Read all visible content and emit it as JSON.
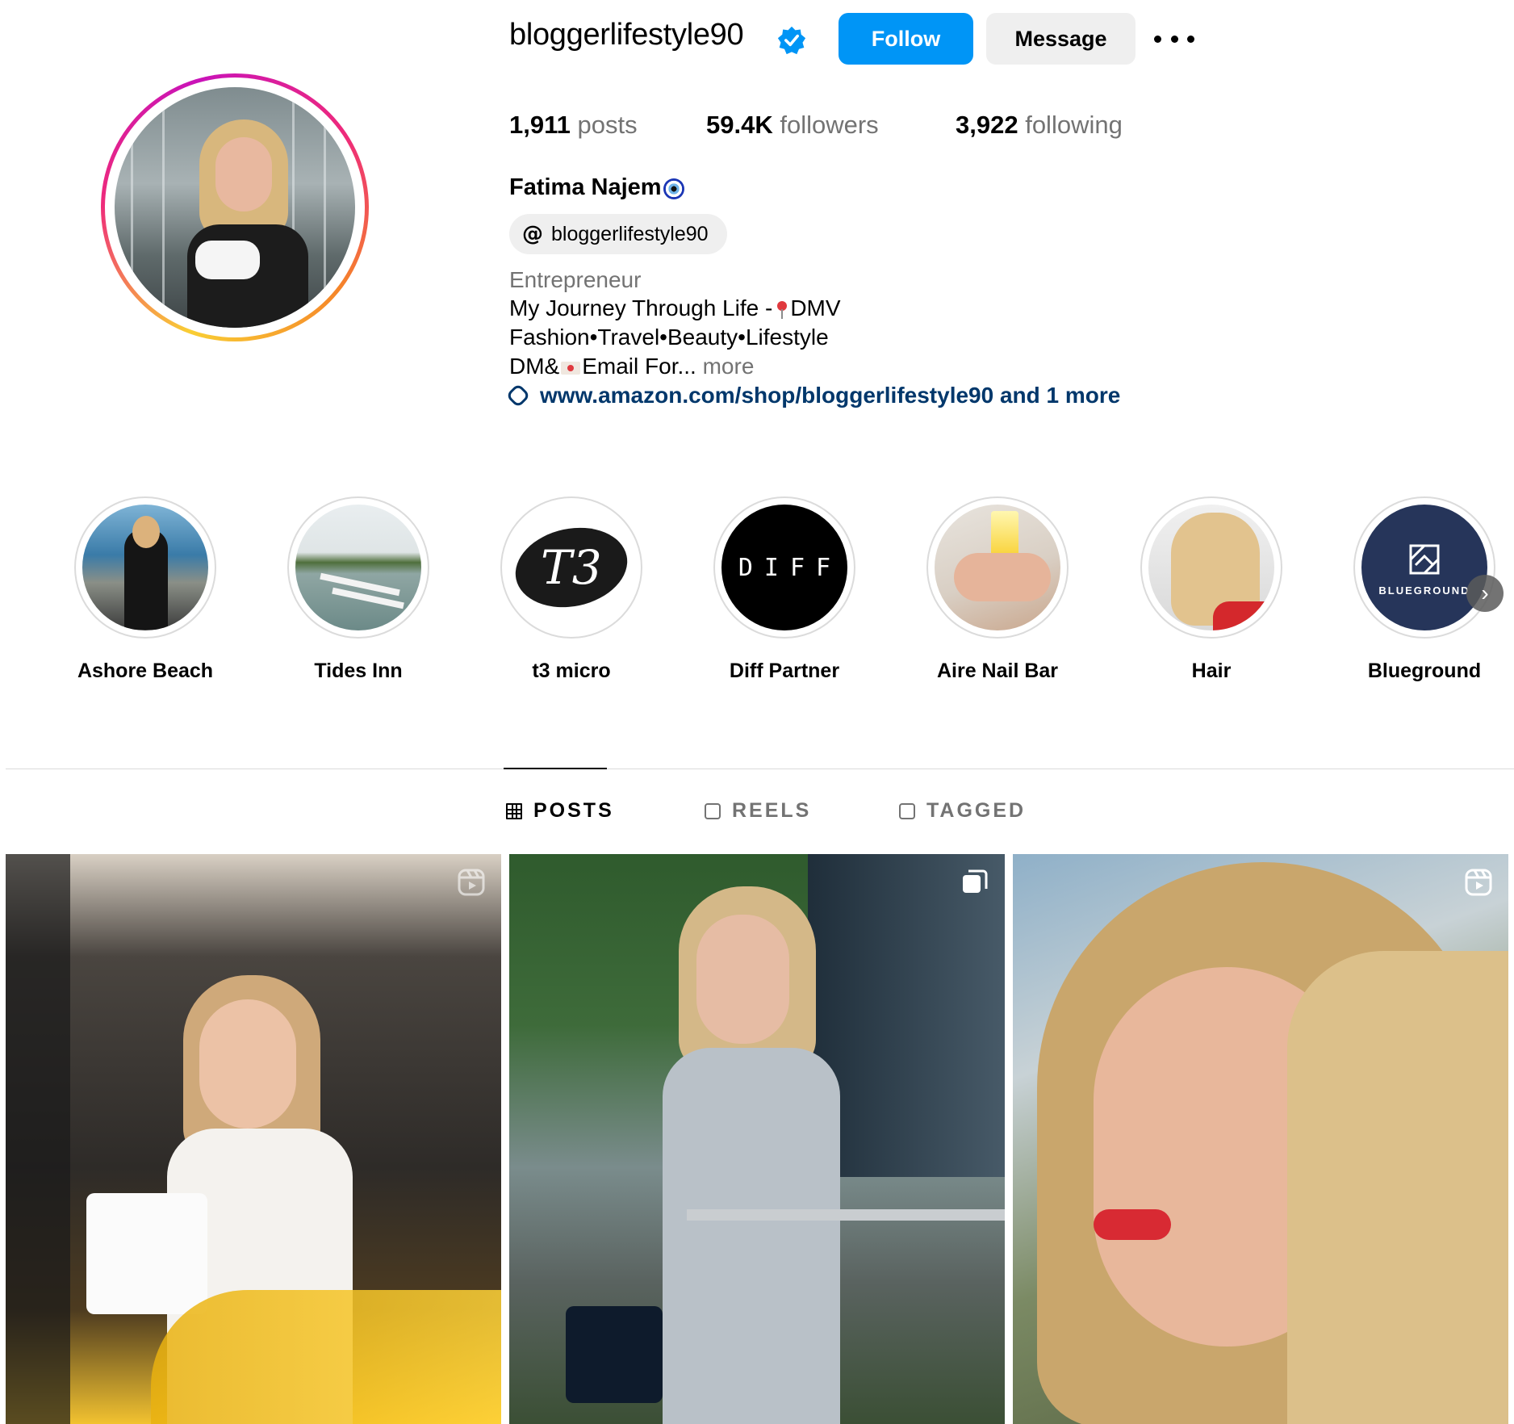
{
  "profile": {
    "username": "bloggerlifestyle90",
    "follow_label": "Follow",
    "message_label": "Message",
    "full_name": "Fatima Najem",
    "threads_handle": "bloggerlifestyle90",
    "category": "Entrepreneur",
    "bio_line1": "My Journey Through Life -",
    "bio_line1_end": "DMV",
    "bio_line2": "Fashion•Travel•Beauty•Lifestyle",
    "bio_line3_start": "DM&",
    "bio_line3_end": "Email For...",
    "bio_more": "more",
    "link": "www.amazon.com/shop/bloggerlifestyle90 and 1 more"
  },
  "stats": {
    "posts_value": "1,911",
    "posts_label": "posts",
    "followers_value": "59.4K",
    "followers_label": "followers",
    "following_value": "3,922",
    "following_label": "following"
  },
  "highlights": [
    {
      "label": "Ashore Beach"
    },
    {
      "label": "Tides Inn"
    },
    {
      "label": "t3 micro",
      "logo_text": "T3"
    },
    {
      "label": "Diff Partner",
      "logo_text": "DIFF"
    },
    {
      "label": "Aire Nail Bar"
    },
    {
      "label": "Hair"
    },
    {
      "label": "Blueground",
      "logo_text": "BLUEGROUND"
    }
  ],
  "tabs": [
    {
      "label": "POSTS",
      "icon": "grid-icon",
      "active": true
    },
    {
      "label": "REELS",
      "icon": "reels-icon",
      "active": false
    },
    {
      "label": "TAGGED",
      "icon": "tagged-icon",
      "active": false
    }
  ],
  "posts": [
    {
      "badge": "reels-icon"
    },
    {
      "badge": "carousel-icon"
    },
    {
      "badge": "reels-icon"
    }
  ],
  "colors": {
    "follow_button": "#0095f6",
    "link": "#00376b",
    "secondary_text": "#737373",
    "verified_badge": "#0095f6"
  }
}
